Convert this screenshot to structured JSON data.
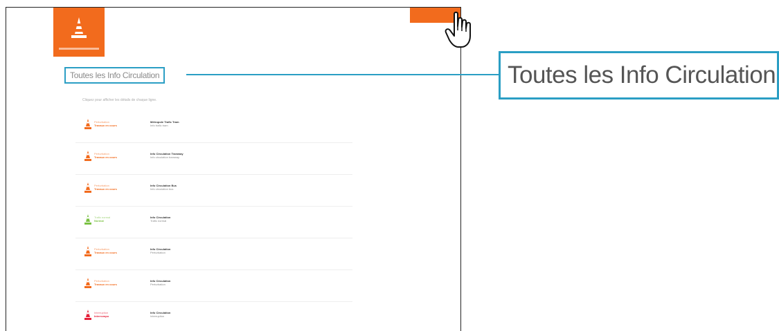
{
  "page": {
    "heading": "Toutes les Info Circulation",
    "subtitle": "Cliquez pour afficher les détails de chaque ligne."
  },
  "callout": {
    "text": "Toutes les Info Circulation"
  },
  "colors": {
    "brand": "#f26b1d",
    "highlight": "#2a9ec4",
    "ok": "#7ac143",
    "alert": "#e5203a"
  },
  "icons": {
    "logo": "traffic-cone-icon",
    "cursor": "hand-pointer-icon"
  },
  "items": [
    {
      "status_line": "Perturbation",
      "status_detail": "Travaux en cours",
      "title": "Métropole Trafic Tram",
      "desc": "Info trafic tram",
      "color": "#f26b1d"
    },
    {
      "status_line": "Perturbation",
      "status_detail": "Travaux en cours",
      "title": "Info Circulation Tramway",
      "desc": "Info circulation tramway",
      "color": "#f26b1d"
    },
    {
      "status_line": "Perturbation",
      "status_detail": "Travaux en cours",
      "title": "Info Circulation Bus",
      "desc": "Info circulation bus",
      "color": "#f26b1d"
    },
    {
      "status_line": "Trafic normal",
      "status_detail": "Normal",
      "title": "Info Circulation",
      "desc": "Trafic normal",
      "color": "#7ac143"
    },
    {
      "status_line": "Perturbation",
      "status_detail": "Travaux en cours",
      "title": "Info Circulation",
      "desc": "Perturbation",
      "color": "#f26b1d"
    },
    {
      "status_line": "Perturbation",
      "status_detail": "Travaux en cours",
      "title": "Info Circulation",
      "desc": "Perturbation",
      "color": "#f26b1d"
    },
    {
      "status_line": "Interruption",
      "status_detail": "Interrompu",
      "title": "Info Circulation",
      "desc": "Interruption",
      "color": "#e5203a"
    }
  ]
}
